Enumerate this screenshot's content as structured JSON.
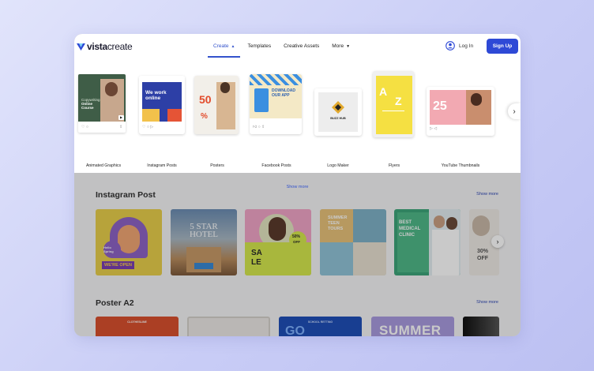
{
  "brand": {
    "name_bold": "vista",
    "name_light": "create",
    "accent": "#2e49d6"
  },
  "nav": {
    "items": [
      {
        "label": "Create",
        "active": true
      },
      {
        "label": "Templates",
        "active": false
      },
      {
        "label": "Creative Assets",
        "active": false
      },
      {
        "label": "More",
        "active": false
      }
    ],
    "login_label": "Log In",
    "signup_label": "Sign Up"
  },
  "create_menu": {
    "categories": [
      {
        "label": "Animated Graphics",
        "preview_lines": [
          "Copywriting",
          "Online",
          "Course"
        ]
      },
      {
        "label": "Instagram Posts",
        "preview_lines": [
          "We work",
          "online"
        ]
      },
      {
        "label": "Posters",
        "preview_lines": [
          "50",
          "%"
        ]
      },
      {
        "label": "Facebook Posts",
        "preview_lines": [
          "DOWNLOAD",
          "OUR APP"
        ]
      },
      {
        "label": "Logo Maker",
        "preview_lines": [
          "BUZZ HUB"
        ]
      },
      {
        "label": "Flyers",
        "preview_lines": [
          "A",
          "Z"
        ]
      },
      {
        "label": "YouTube Thumbnails",
        "preview_lines": [
          "25"
        ]
      }
    ],
    "show_more_label": "Show more"
  },
  "sections": [
    {
      "title": "Instagram Post",
      "show_more_label": "Show more",
      "tiles": [
        {
          "lines": [
            "Hello Spring",
            "WE'RE OPEN"
          ],
          "color": "#e6c84a"
        },
        {
          "lines": [
            "5 STAR",
            "HOTEL"
          ],
          "color": "#5c7fa4"
        },
        {
          "lines": [
            "SA",
            "LE",
            "50%",
            "OFF"
          ],
          "color": "#f0a2c4"
        },
        {
          "lines": [
            "SUMMER",
            "TEEN",
            "TOURS"
          ],
          "color": "#8cc0d6"
        },
        {
          "lines": [
            "BEST",
            "MEDICAL",
            "CLINIC"
          ],
          "color": "#3ea67a"
        },
        {
          "lines": [
            "30%",
            "OFF"
          ],
          "color": "#e8e4df"
        }
      ]
    },
    {
      "title": "Poster A2",
      "show_more_label": "Show more",
      "tiles": [
        {
          "lines": [
            "CLOTHESLINE"
          ],
          "color": "#d9502e"
        },
        {
          "lines": [
            ""
          ],
          "color": "#e8e4df"
        },
        {
          "lines": [
            "SCHOOL RETTING"
          ],
          "color": "#1f4fb8"
        },
        {
          "lines": [
            "SUMMER"
          ],
          "color": "#a99be0"
        },
        {
          "lines": [
            ""
          ],
          "color": "#111111"
        }
      ]
    }
  ]
}
